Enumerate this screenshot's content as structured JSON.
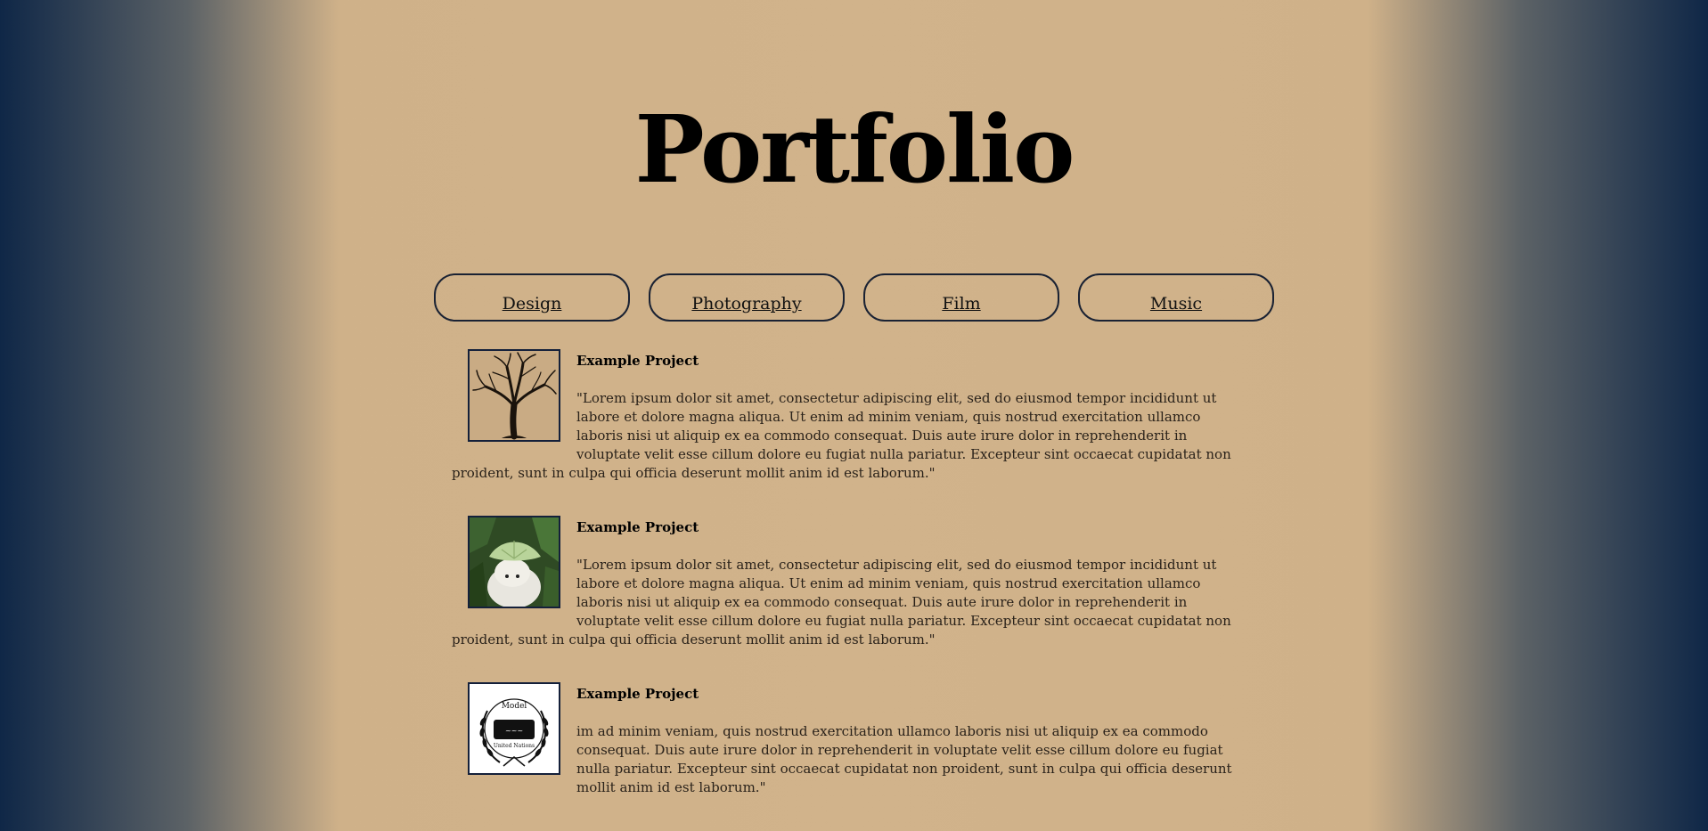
{
  "page": {
    "title": "Portfolio"
  },
  "nav": {
    "items": [
      {
        "label": "Design"
      },
      {
        "label": "Photography"
      },
      {
        "label": "Film"
      },
      {
        "label": "Music"
      }
    ]
  },
  "projects": [
    {
      "title": "Example Project",
      "image": "tree-image",
      "text": "\"Lorem ipsum dolor sit amet, consectetur adipiscing elit, sed do eiusmod tempor incididunt ut labore et dolore magna aliqua. Ut enim ad minim veniam, quis nostrud exercitation ullamco laboris nisi ut aliquip ex ea commodo consequat. Duis aute irure dolor in reprehenderit in voluptate velit esse cillum dolore eu fugiat nulla pariatur. Excepteur sint occaecat cupidatat non proident, sunt in culpa qui officia deserunt mollit anim id est laborum.\""
    },
    {
      "title": "Example Project",
      "image": "dog-photo-image",
      "text": "\"Lorem ipsum dolor sit amet, consectetur adipiscing elit, sed do eiusmod tempor incididunt ut labore et dolore magna aliqua. Ut enim ad minim veniam, quis nostrud exercitation ullamco laboris nisi ut aliquip ex ea commodo consequat. Duis aute irure dolor in reprehenderit in voluptate velit esse cillum dolore eu fugiat nulla pariatur. Excepteur sint occaecat cupidatat non proident, sunt in culpa qui officia deserunt mollit anim id est laborum.\""
    },
    {
      "title": "Example Project",
      "image": "model-un-logo-image",
      "text": "im ad minim veniam, quis nostrud exercitation ullamco laboris nisi ut aliquip ex ea commodo consequat. Duis aute irure dolor in reprehenderit in voluptate velit esse cillum dolore eu fugiat nulla pariatur. Excepteur sint occaecat cupidatat non proident, sunt in culpa qui officia deserunt mollit anim id est laborum.\"",
      "logo_top": "Model",
      "logo_bottom": "United Nations"
    }
  ],
  "colors": {
    "background_center": "#d1b38b",
    "background_edge": "#0f2747",
    "border": "#1a2233"
  }
}
